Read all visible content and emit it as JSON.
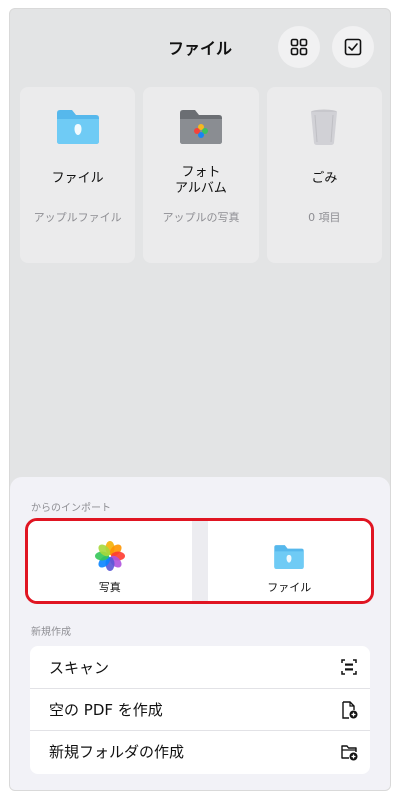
{
  "header": {
    "title": "ファイル"
  },
  "cards": [
    {
      "name": "ファイル",
      "subtitle": "アップルファイル",
      "icon": "folder-icon"
    },
    {
      "name": "フォト\nアルバム",
      "subtitle": "アップルの写真",
      "icon": "photo-album-folder-icon"
    },
    {
      "name": "ごみ",
      "subtitle": "0 項目",
      "icon": "trash-icon"
    }
  ],
  "sheet": {
    "import_label": "からのインポート",
    "import_options": [
      {
        "label": "写真",
        "icon": "photos-app-icon"
      },
      {
        "label": "ファイル",
        "icon": "folder-icon"
      }
    ],
    "new_label": "新規作成",
    "actions": [
      {
        "label": "スキャン",
        "icon": "scan-icon"
      },
      {
        "label": "空の PDF を作成",
        "icon": "new-pdf-icon"
      },
      {
        "label": "新規フォルダの作成",
        "icon": "new-folder-icon"
      }
    ]
  },
  "colors": {
    "highlight": "#e01522",
    "folder_blue": "#5ac8fa"
  }
}
